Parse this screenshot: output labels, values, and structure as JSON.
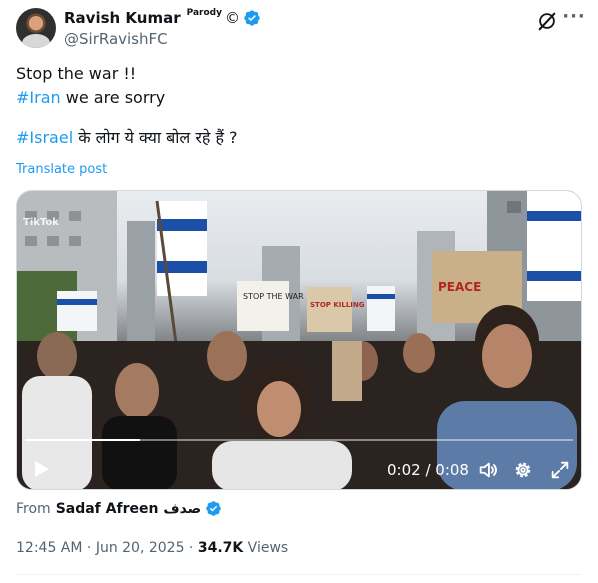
{
  "author": {
    "display_name": "Ravish Kumar",
    "parody_tag": "Parody",
    "copyright_symbol": "©",
    "handle": "@SirRavishFC",
    "verified": true
  },
  "tweet": {
    "line1": "Stop the war !!",
    "line2_hashtag": "#Iran",
    "line2_text": " we are sorry",
    "line3_hashtag": "#Israel",
    "line3_text": " के लोग ये क्या बोल रहे हैं ?",
    "translate_label": "Translate post"
  },
  "video": {
    "watermark": "TikTok",
    "current_time": "0:02",
    "separator": " / ",
    "duration": "0:08",
    "progress_fraction": 0.21,
    "sign_texts": [
      "STOP THE WAR",
      "PEACE",
      "STOP KILLING"
    ]
  },
  "source": {
    "prefix": "From",
    "name": "Sadaf Afreen صدف",
    "verified": true
  },
  "meta": {
    "time": "12:45 AM",
    "dot": " · ",
    "date": "Jun 20, 2025",
    "views_count": "34.7K",
    "views_label": " Views"
  },
  "colors": {
    "accent": "#1d9bf0",
    "muted": "#536471",
    "text": "#0f1419"
  },
  "icons": {
    "verified": "verified-badge-icon",
    "grok": "grok-icon",
    "more": "more-icon",
    "play": "play-icon",
    "volume": "volume-icon",
    "settings": "settings-icon",
    "fullscreen": "fullscreen-icon"
  }
}
